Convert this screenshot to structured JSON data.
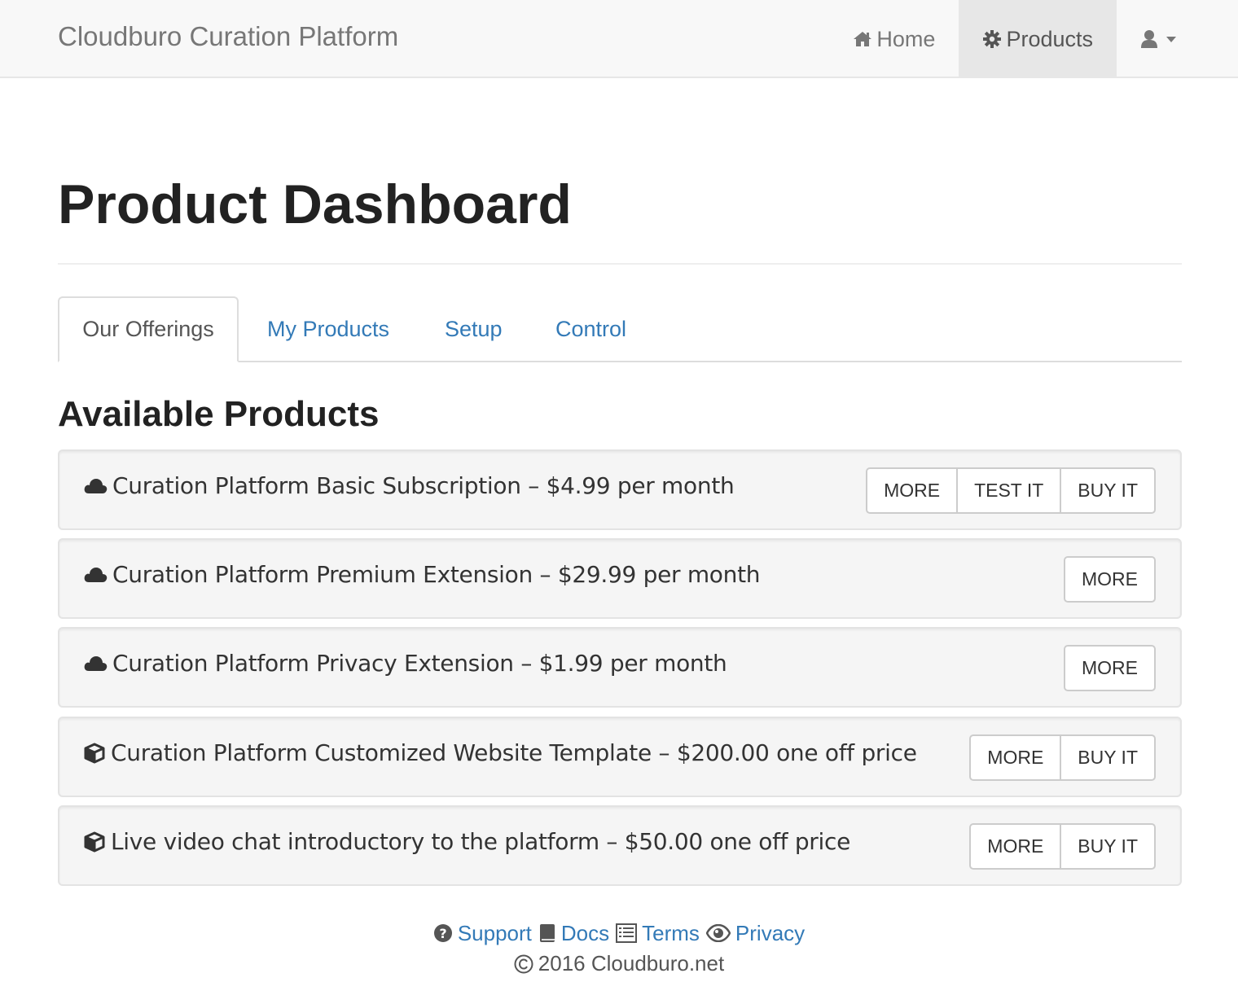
{
  "navbar": {
    "brand": "Cloudburo Curation Platform",
    "items": [
      {
        "label": "Home",
        "icon": "home-icon"
      },
      {
        "label": "Products",
        "icon": "gear-icon",
        "active": true
      }
    ],
    "user_icon": "user-icon"
  },
  "page": {
    "title": "Product Dashboard",
    "tabs": [
      {
        "label": "Our Offerings",
        "active": true
      },
      {
        "label": "My Products"
      },
      {
        "label": "Setup"
      },
      {
        "label": "Control"
      }
    ],
    "section_title": "Available Products"
  },
  "products": [
    {
      "icon": "cloud-icon",
      "label": "Curation Platform Basic Subscription – $4.99 per month",
      "buttons": [
        "MORE",
        "TEST IT",
        "BUY IT"
      ]
    },
    {
      "icon": "cloud-icon",
      "label": "Curation Platform Premium Extension – $29.99 per month",
      "buttons": [
        "MORE"
      ]
    },
    {
      "icon": "cloud-icon",
      "label": "Curation Platform Privacy Extension – $1.99 per month",
      "buttons": [
        "MORE"
      ]
    },
    {
      "icon": "cube-icon",
      "label": "Curation Platform Customized Website Template – $200.00 one off price",
      "buttons": [
        "MORE",
        "BUY IT"
      ]
    },
    {
      "icon": "cube-icon",
      "label": "Live video chat introductory to the platform – $50.00 one off price",
      "buttons": [
        "MORE",
        "BUY IT"
      ]
    }
  ],
  "footer": {
    "links": [
      {
        "label": "Support",
        "icon": "question-circle-icon"
      },
      {
        "label": "Docs",
        "icon": "book-icon"
      },
      {
        "label": "Terms",
        "icon": "list-alt-icon"
      },
      {
        "label": "Privacy",
        "icon": "eye-icon"
      }
    ],
    "copyright": "2016 Cloudburo.net"
  },
  "colors": {
    "link": "#337ab7",
    "navbar_bg": "#f8f8f8",
    "panel_bg": "#f5f5f5"
  }
}
